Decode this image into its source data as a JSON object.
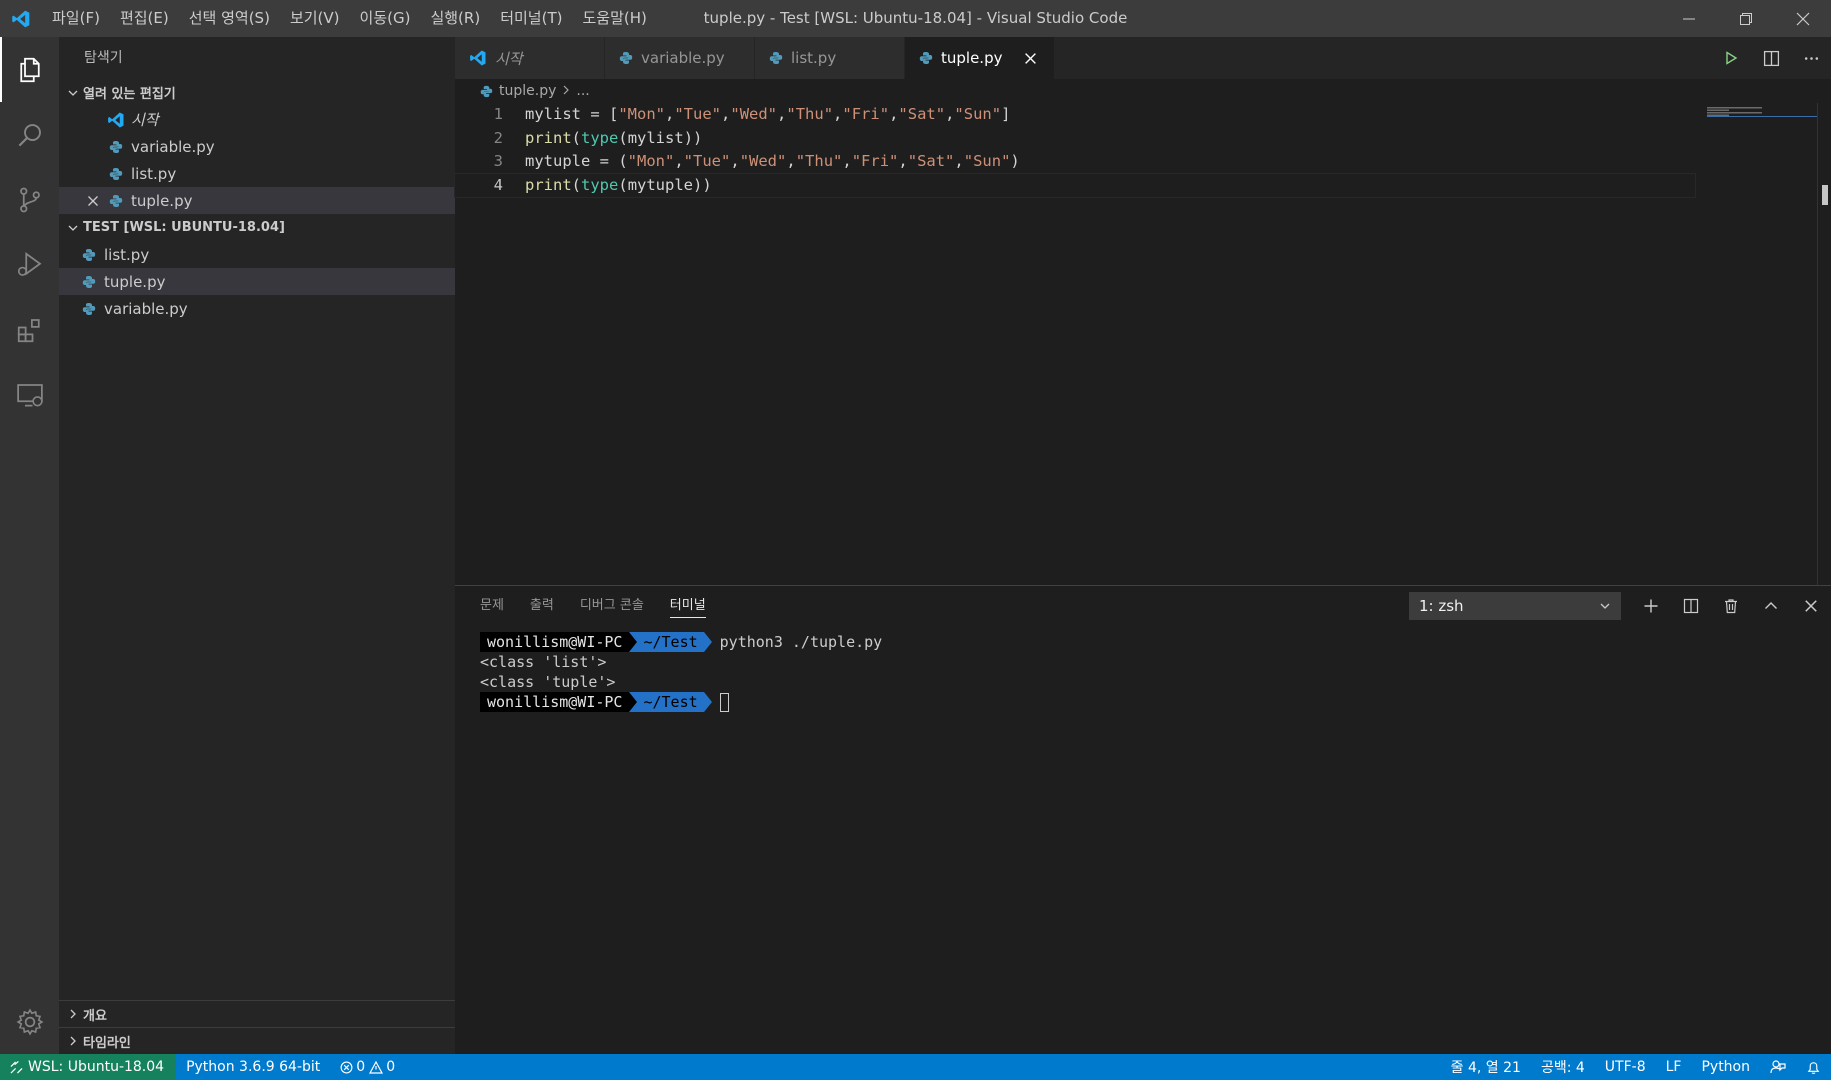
{
  "window": {
    "title": "tuple.py - Test [WSL: Ubuntu-18.04] - Visual Studio Code",
    "menu": [
      "파일(F)",
      "편집(E)",
      "선택 영역(S)",
      "보기(V)",
      "이동(G)",
      "실행(R)",
      "터미널(T)",
      "도움말(H)"
    ]
  },
  "sidebar": {
    "title": "탐색기",
    "open_editors": {
      "header": "열려 있는 편집기",
      "items": [
        {
          "label": "시작",
          "icon": "vscode-logo-icon"
        },
        {
          "label": "variable.py",
          "icon": "python-icon"
        },
        {
          "label": "list.py",
          "icon": "python-icon"
        },
        {
          "label": "tuple.py",
          "icon": "python-icon"
        }
      ]
    },
    "workspace": {
      "header": "TEST [WSL: UBUNTU-18.04]",
      "items": [
        {
          "label": "list.py",
          "icon": "python-icon"
        },
        {
          "label": "tuple.py",
          "icon": "python-icon"
        },
        {
          "label": "variable.py",
          "icon": "python-icon"
        }
      ]
    },
    "outline_label": "개요",
    "timeline_label": "타임라인"
  },
  "tabs": [
    {
      "label": "시작",
      "icon": "vscode-logo-icon"
    },
    {
      "label": "variable.py",
      "icon": "python-icon"
    },
    {
      "label": "list.py",
      "icon": "python-icon"
    },
    {
      "label": "tuple.py",
      "icon": "python-icon",
      "active": true
    }
  ],
  "breadcrumb": {
    "file": "tuple.py",
    "more": "..."
  },
  "code": {
    "line_numbers": [
      "1",
      "2",
      "3",
      "4"
    ],
    "lines": [
      "mylist = [\"Mon\",\"Tue\",\"Wed\",\"Thu\",\"Fri\",\"Sat\",\"Sun\"]",
      "print(type(mylist))",
      "mytuple = (\"Mon\",\"Tue\",\"Wed\",\"Thu\",\"Fri\",\"Sat\",\"Sun\")",
      "print(type(mytuple))"
    ]
  },
  "panel": {
    "tabs": [
      "문제",
      "출력",
      "디버그 콘솔",
      "터미널"
    ],
    "active_tab": "터미널",
    "terminal_select": "1: zsh",
    "prompt_user": "wonillism@WI-PC",
    "prompt_dir": "~/Test",
    "command": "python3 ./tuple.py",
    "output": [
      "<class 'list'>",
      "<class 'tuple'>"
    ]
  },
  "statusbar": {
    "remote": "WSL: Ubuntu-18.04",
    "interpreter": "Python 3.6.9 64-bit",
    "errors": "0",
    "warnings": "0",
    "position": "줄 4, 열 21",
    "spaces": "공백: 4",
    "encoding": "UTF-8",
    "eol": "LF",
    "language": "Python"
  },
  "colors": {
    "accent": "#007acc",
    "remote": "#16825d",
    "python_icon": "#519aba",
    "vscode_logo": "#23a9f2"
  }
}
